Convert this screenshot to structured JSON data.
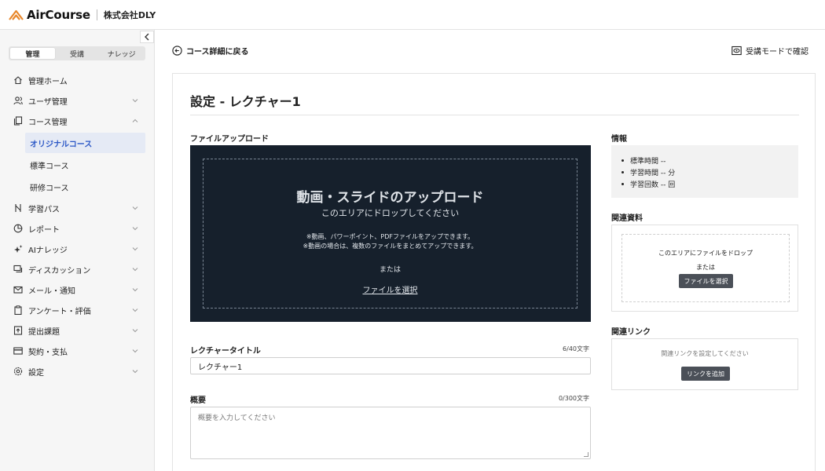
{
  "header": {
    "brand": "AirCourse",
    "company": "株式会社DLY",
    "brand_color": "#e8872a"
  },
  "sidebar": {
    "collapse_icon": "chevron-left-icon",
    "modes": [
      {
        "label": "管理",
        "active": true
      },
      {
        "label": "受講",
        "active": false
      },
      {
        "label": "ナレッジ",
        "active": false
      }
    ],
    "items": [
      {
        "label": "管理ホーム",
        "icon": "home-icon"
      },
      {
        "label": "ユーザ管理",
        "icon": "users-icon",
        "chevron": "down"
      },
      {
        "label": "コース管理",
        "icon": "copy-icon",
        "chevron": "up"
      },
      {
        "label": "学習パス",
        "icon": "route-icon",
        "chevron": "down"
      },
      {
        "label": "レポート",
        "icon": "pie-chart-icon",
        "chevron": "down"
      },
      {
        "label": "AIナレッジ",
        "icon": "sparkle-icon",
        "chevron": "down"
      },
      {
        "label": "ディスカッション",
        "icon": "chat-icon",
        "chevron": "down"
      },
      {
        "label": "メール・通知",
        "icon": "mail-icon",
        "chevron": "down"
      },
      {
        "label": "アンケート・評価",
        "icon": "clipboard-icon",
        "chevron": "down"
      },
      {
        "label": "提出課題",
        "icon": "upload-file-icon",
        "chevron": "down"
      },
      {
        "label": "契約・支払",
        "icon": "card-icon",
        "chevron": "down"
      },
      {
        "label": "設定",
        "icon": "gear-icon",
        "chevron": "down"
      }
    ],
    "course_sub": [
      {
        "label": "オリジナルコース",
        "active": true
      },
      {
        "label": "標準コース",
        "active": false
      },
      {
        "label": "研修コース",
        "active": false
      }
    ],
    "active_color": "#2c58c6"
  },
  "main": {
    "back_label": "コース詳細に戻る",
    "preview_label": "受講モードで確認",
    "title": "設定 - レクチャー1",
    "file_upload": {
      "label": "ファイルアップロード",
      "heading": "動画・スライドのアップロード",
      "sub": "このエリアにドロップしてください",
      "note1": "※動画、パワーポイント、PDFファイルをアップできます。",
      "note2": "※動画の場合は、複数のファイルをまとめてアップできます。",
      "or": "または",
      "select_link": "ファイルを選択"
    },
    "lecture_title": {
      "label": "レクチャータイトル",
      "count": "6/40文字",
      "value": "レクチャー1"
    },
    "summary": {
      "label": "概要",
      "count": "0/300文字",
      "placeholder": "概要を入力してください"
    },
    "info": {
      "label": "情報",
      "items": [
        "標準時間 --",
        "学習時間 -- 分",
        "学習回数 -- 回"
      ]
    },
    "resources": {
      "label": "関連資料",
      "drop_text": "このエリアにファイルをドロップ",
      "or": "または",
      "button": "ファイルを選択"
    },
    "links": {
      "label": "関連リンク",
      "empty_text": "関連リンクを設定してください",
      "button": "リンクを追加"
    }
  }
}
